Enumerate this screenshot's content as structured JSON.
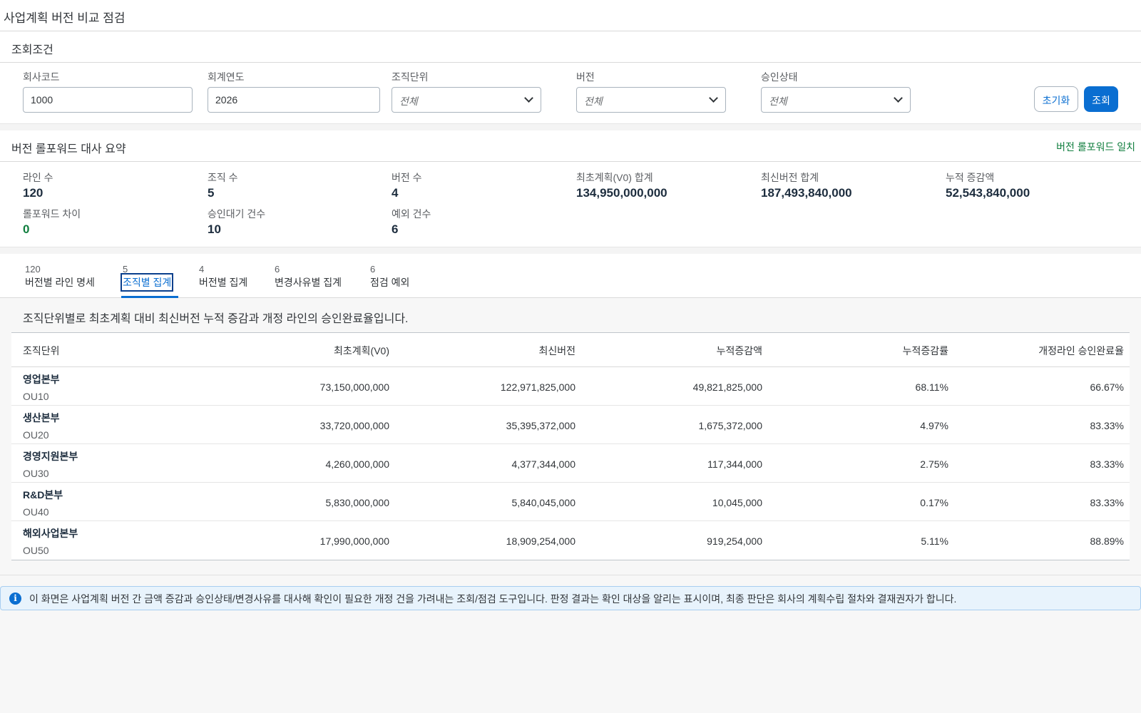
{
  "page": {
    "title": "사업계획 버전 비교 점검"
  },
  "filters": {
    "section_title": "조회조건",
    "company_code": {
      "label": "회사코드",
      "value": "1000"
    },
    "fiscal_year": {
      "label": "회계연도",
      "value": "2026"
    },
    "org_unit": {
      "label": "조직단위",
      "value": "전체"
    },
    "version": {
      "label": "버전",
      "value": "전체"
    },
    "approval_status": {
      "label": "승인상태",
      "value": "전체"
    },
    "reset_label": "초기화",
    "search_label": "조회"
  },
  "summary": {
    "title": "버전 롤포워드 대사 요약",
    "status": "버전 롤포워드 일치",
    "line_count": {
      "label": "라인 수",
      "value": "120"
    },
    "org_count": {
      "label": "조직 수",
      "value": "5"
    },
    "version_count": {
      "label": "버전 수",
      "value": "4"
    },
    "initial_total": {
      "label": "최초계획(V0) 합계",
      "value": "134,950,000,000"
    },
    "latest_total": {
      "label": "최신버전 합계",
      "value": "187,493,840,000"
    },
    "cumulative_change": {
      "label": "누적 증감액",
      "value": "52,543,840,000"
    },
    "rollforward_diff": {
      "label": "롤포워드 차이",
      "value": "0"
    },
    "pending_approval": {
      "label": "승인대기 건수",
      "value": "10"
    },
    "exception_count": {
      "label": "예외 건수",
      "value": "6"
    }
  },
  "tabs": [
    {
      "count": "120",
      "label": "버전별 라인 명세"
    },
    {
      "count": "5",
      "label": "조직별 집계"
    },
    {
      "count": "4",
      "label": "버전별 집계"
    },
    {
      "count": "6",
      "label": "변경사유별 집계"
    },
    {
      "count": "6",
      "label": "점검 예외"
    }
  ],
  "table": {
    "description": "조직단위별로 최초계획 대비 최신버전 누적 증감과 개정 라인의 승인완료율입니다.",
    "columns": [
      "조직단위",
      "최초계획(V0)",
      "최신버전",
      "누적증감액",
      "누적증감률",
      "개정라인 승인완료율"
    ],
    "rows": [
      {
        "name": "영업본부",
        "code": "OU10",
        "initial": "73,150,000,000",
        "latest": "122,971,825,000",
        "change": "49,821,825,000",
        "rate": "68.11%",
        "approval": "66.67%"
      },
      {
        "name": "생산본부",
        "code": "OU20",
        "initial": "33,720,000,000",
        "latest": "35,395,372,000",
        "change": "1,675,372,000",
        "rate": "4.97%",
        "approval": "83.33%"
      },
      {
        "name": "경영지원본부",
        "code": "OU30",
        "initial": "4,260,000,000",
        "latest": "4,377,344,000",
        "change": "117,344,000",
        "rate": "2.75%",
        "approval": "83.33%"
      },
      {
        "name": "R&D본부",
        "code": "OU40",
        "initial": "5,830,000,000",
        "latest": "5,840,045,000",
        "change": "10,045,000",
        "rate": "0.17%",
        "approval": "83.33%"
      },
      {
        "name": "해외사업본부",
        "code": "OU50",
        "initial": "17,990,000,000",
        "latest": "18,909,254,000",
        "change": "919,254,000",
        "rate": "5.11%",
        "approval": "88.89%"
      }
    ]
  },
  "notice": {
    "icon": "info-icon",
    "text": "이 화면은 사업계획 버전 간 금액 증감과 승인상태/변경사유를 대사해 확인이 필요한 개정 건을 가려내는 조회/점검 도구입니다. 판정 결과는 확인 대상을 알리는 표시이며, 최종 판단은 회사의 계획수립 절차와 결재권자가 합니다."
  }
}
